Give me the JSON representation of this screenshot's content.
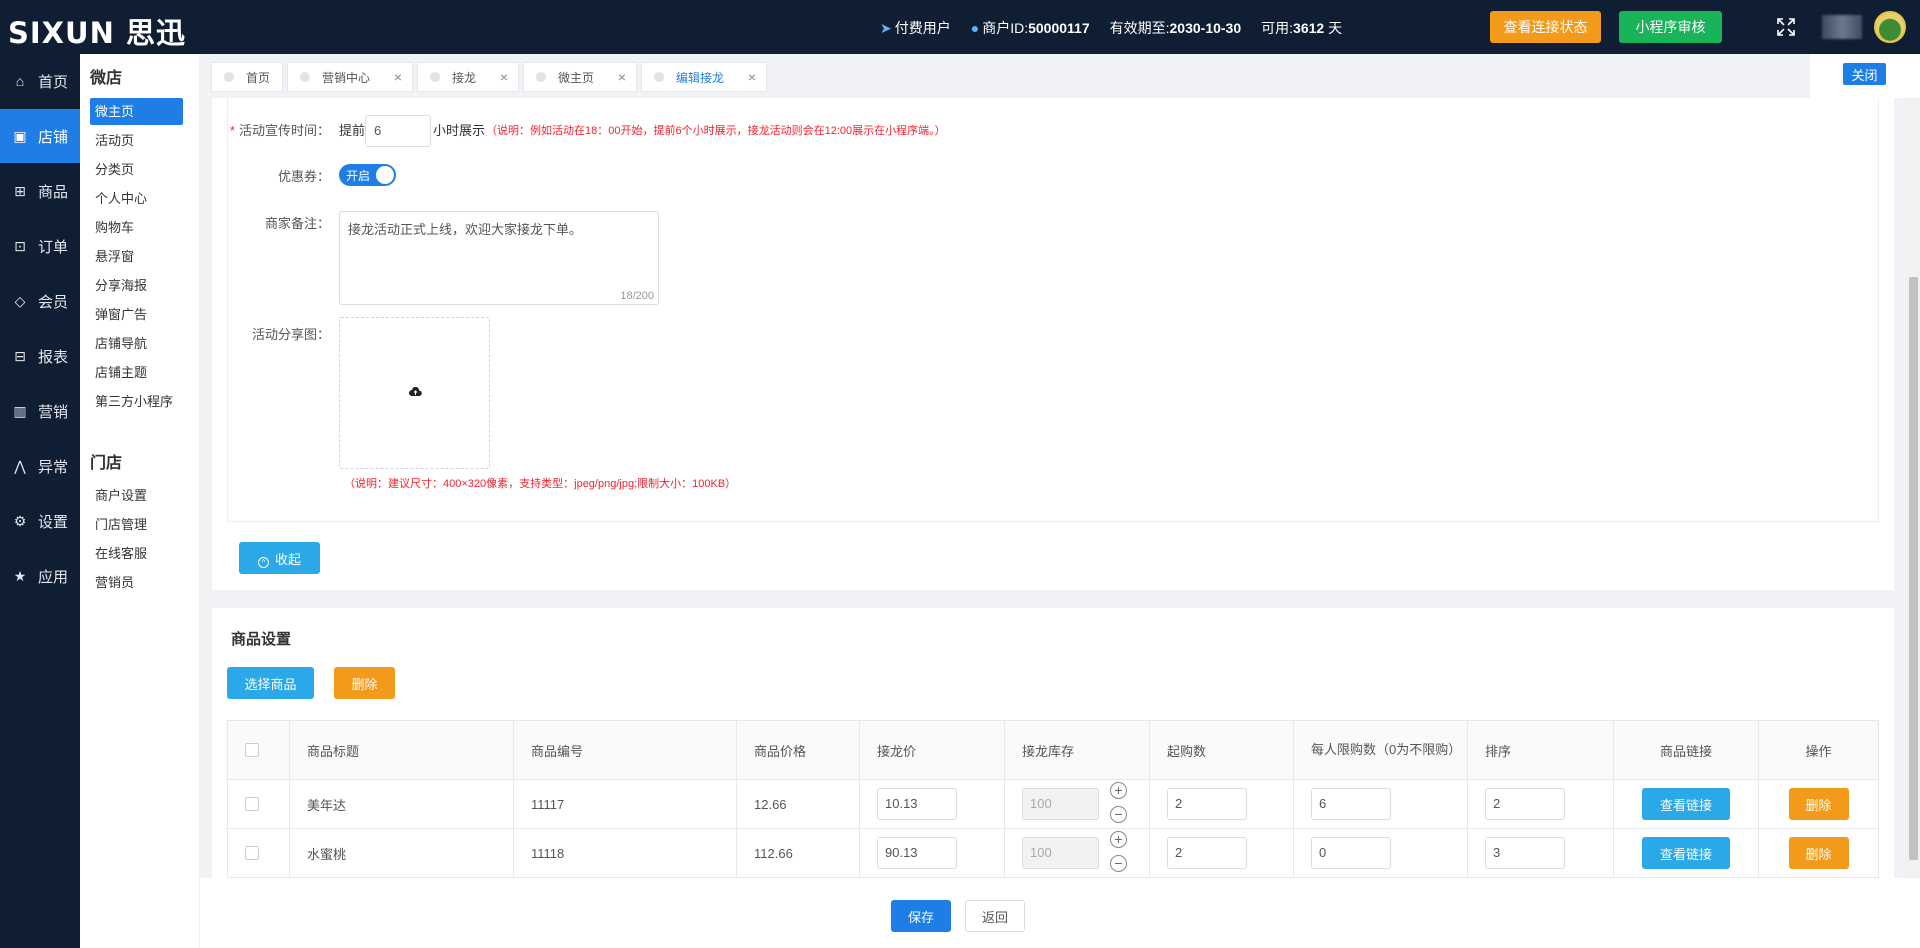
{
  "header": {
    "logo": "SIXUN 思迅",
    "user_type": "付费用户",
    "merchant_label": "商户ID:",
    "merchant_id": "50000117",
    "valid_label": "有效期至:",
    "valid_until": "2030-10-30",
    "available_label": "可用:",
    "available_days": "3612",
    "days_unit": "天",
    "btn_status": "查看连接状态",
    "btn_review": "小程序审核"
  },
  "nav": [
    {
      "label": "首页",
      "icon": "home-icon",
      "active": false
    },
    {
      "label": "店铺",
      "icon": "shop-icon",
      "active": true
    },
    {
      "label": "商品",
      "icon": "gift-icon",
      "active": false
    },
    {
      "label": "订单",
      "icon": "order-icon",
      "active": false
    },
    {
      "label": "会员",
      "icon": "diamond-icon",
      "active": false
    },
    {
      "label": "报表",
      "icon": "report-icon",
      "active": false
    },
    {
      "label": "营销",
      "icon": "chart-icon",
      "active": false
    },
    {
      "label": "异常",
      "icon": "warning-icon",
      "active": false
    },
    {
      "label": "设置",
      "icon": "gear-icon",
      "active": false
    },
    {
      "label": "应用",
      "icon": "star-icon",
      "active": false
    }
  ],
  "subnav": {
    "section1": "微店",
    "items1": [
      "微主页",
      "活动页",
      "分类页",
      "个人中心",
      "购物车",
      "悬浮窗",
      "分享海报",
      "弹窗广告",
      "店铺导航",
      "店铺主题",
      "第三方小程序"
    ],
    "section2": "门店",
    "items2": [
      "商户设置",
      "门店管理",
      "在线客服",
      "营销员"
    ]
  },
  "tabs": [
    {
      "label": "首页",
      "closable": false,
      "active": false
    },
    {
      "label": "营销中心",
      "closable": true,
      "active": false
    },
    {
      "label": "接龙",
      "closable": true,
      "active": false
    },
    {
      "label": "微主页",
      "closable": true,
      "active": false
    },
    {
      "label": "编辑接龙",
      "closable": true,
      "active": true
    }
  ],
  "close_btn": "关闭",
  "form": {
    "promo_label": "活动宣传时间：",
    "promo_prefix": "提前",
    "promo_value": "6",
    "promo_suffix": "小时展示",
    "promo_note": "（说明：例如活动在18：00开始，提前6个小时展示，接龙活动则会在12:00展示在小程序端。）",
    "coupon_label": "优惠券：",
    "coupon_switch": "开启",
    "remark_label": "商家备注：",
    "remark_value": "接龙活动正式上线，欢迎大家接龙下单。",
    "remark_count": "18/200",
    "share_label": "活动分享图：",
    "share_note": "（说明：建议尺寸：400×320像素，支持类型：jpeg/png/jpg;限制大小：100KB）",
    "collapse_btn": "收起"
  },
  "products": {
    "title": "商品设置",
    "btn_select": "选择商品",
    "btn_delete": "删除",
    "columns": [
      "商品标题",
      "商品编号",
      "商品价格",
      "接龙价",
      "接龙库存",
      "起购数",
      "每人限购数（0为不限购）",
      "排序",
      "商品链接",
      "操作"
    ],
    "rows": [
      {
        "title": "美年达",
        "code": "11117",
        "price": "12.66",
        "jl_price": "10.13",
        "stock": "100",
        "min_buy": "2",
        "limit": "6",
        "sort": "2",
        "link": "查看链接",
        "op": "删除"
      },
      {
        "title": "水蜜桃",
        "code": "11118",
        "price": "112.66",
        "jl_price": "90.13",
        "stock": "100",
        "min_buy": "2",
        "limit": "0",
        "sort": "3",
        "link": "查看链接",
        "op": "删除"
      }
    ]
  },
  "footer": {
    "save": "保存",
    "back": "返回"
  }
}
